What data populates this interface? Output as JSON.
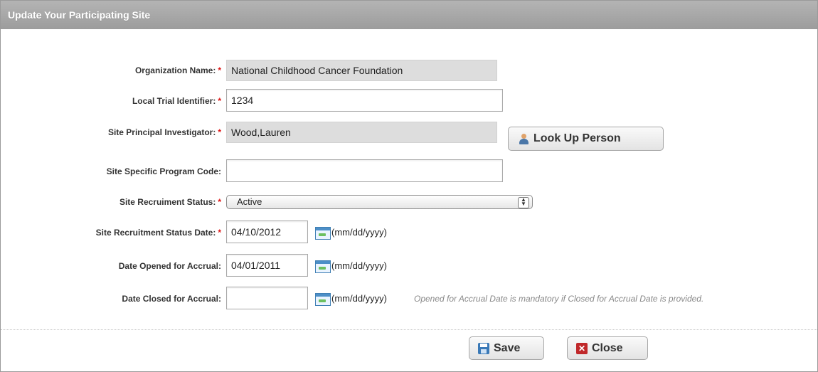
{
  "header": {
    "title": "Update Your Participating Site"
  },
  "form": {
    "organization_name": {
      "label": "Organization Name:",
      "value": "National Childhood Cancer Foundation",
      "required": "*"
    },
    "local_trial_identifier": {
      "label": "Local Trial Identifier:",
      "value": "1234",
      "required": "*"
    },
    "site_principal_investigator": {
      "label": "Site Principal Investigator:",
      "value": "Wood,Lauren",
      "required": "*"
    },
    "look_up_person": {
      "label": "Look Up Person"
    },
    "site_program_code": {
      "label": "Site Specific Program Code:",
      "value": ""
    },
    "site_recruitment_status": {
      "label": "Site Recruiment Status:",
      "value": "Active",
      "required": "*"
    },
    "site_recruitment_status_date": {
      "label": "Site Recruitment Status Date:",
      "value": "04/10/2012",
      "required": "*",
      "format": "(mm/dd/yyyy)"
    },
    "date_opened": {
      "label": "Date Opened for Accrual:",
      "value": "04/01/2011",
      "format": "(mm/dd/yyyy)"
    },
    "date_closed": {
      "label": "Date Closed for Accrual:",
      "value": "",
      "format": "(mm/dd/yyyy)",
      "hint": "Opened for Accrual Date is mandatory if Closed for Accrual Date is provided."
    }
  },
  "buttons": {
    "save": "Save",
    "close": "Close"
  },
  "icons": {
    "look_up": "person-icon",
    "calendar": "calendar-icon",
    "save": "save-icon",
    "close": "close-x-icon"
  },
  "colors": {
    "required": "#dd1111",
    "header_bg": "#a8a8a8",
    "readonly_bg": "#dddddd"
  }
}
